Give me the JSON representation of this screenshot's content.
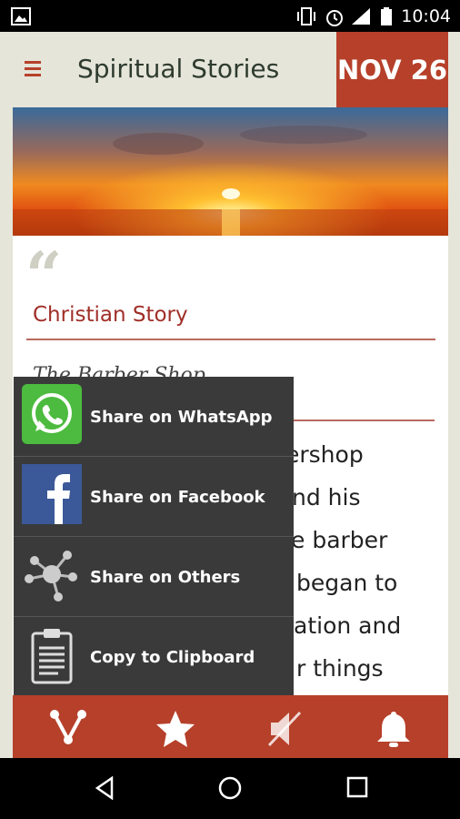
{
  "status_bar": {
    "time": "10:04"
  },
  "app_bar": {
    "title": "Spiritual Stories",
    "date": "NOV 26"
  },
  "card": {
    "category": "Christian Story",
    "story_title": "The Barber Shop",
    "story_lines": [
      "ershop",
      "nd his",
      "e barber",
      "began to",
      "ation and",
      "r things"
    ]
  },
  "share_menu": {
    "items": [
      {
        "label": "Share on WhatsApp"
      },
      {
        "label": "Share on Facebook"
      },
      {
        "label": "Share on Others"
      },
      {
        "label": "Copy to Clipboard"
      }
    ]
  },
  "colors": {
    "accent": "#b6402a",
    "whatsapp": "#4cbb3f",
    "facebook": "#3b5998",
    "menu_bg": "#3a3a3a"
  }
}
